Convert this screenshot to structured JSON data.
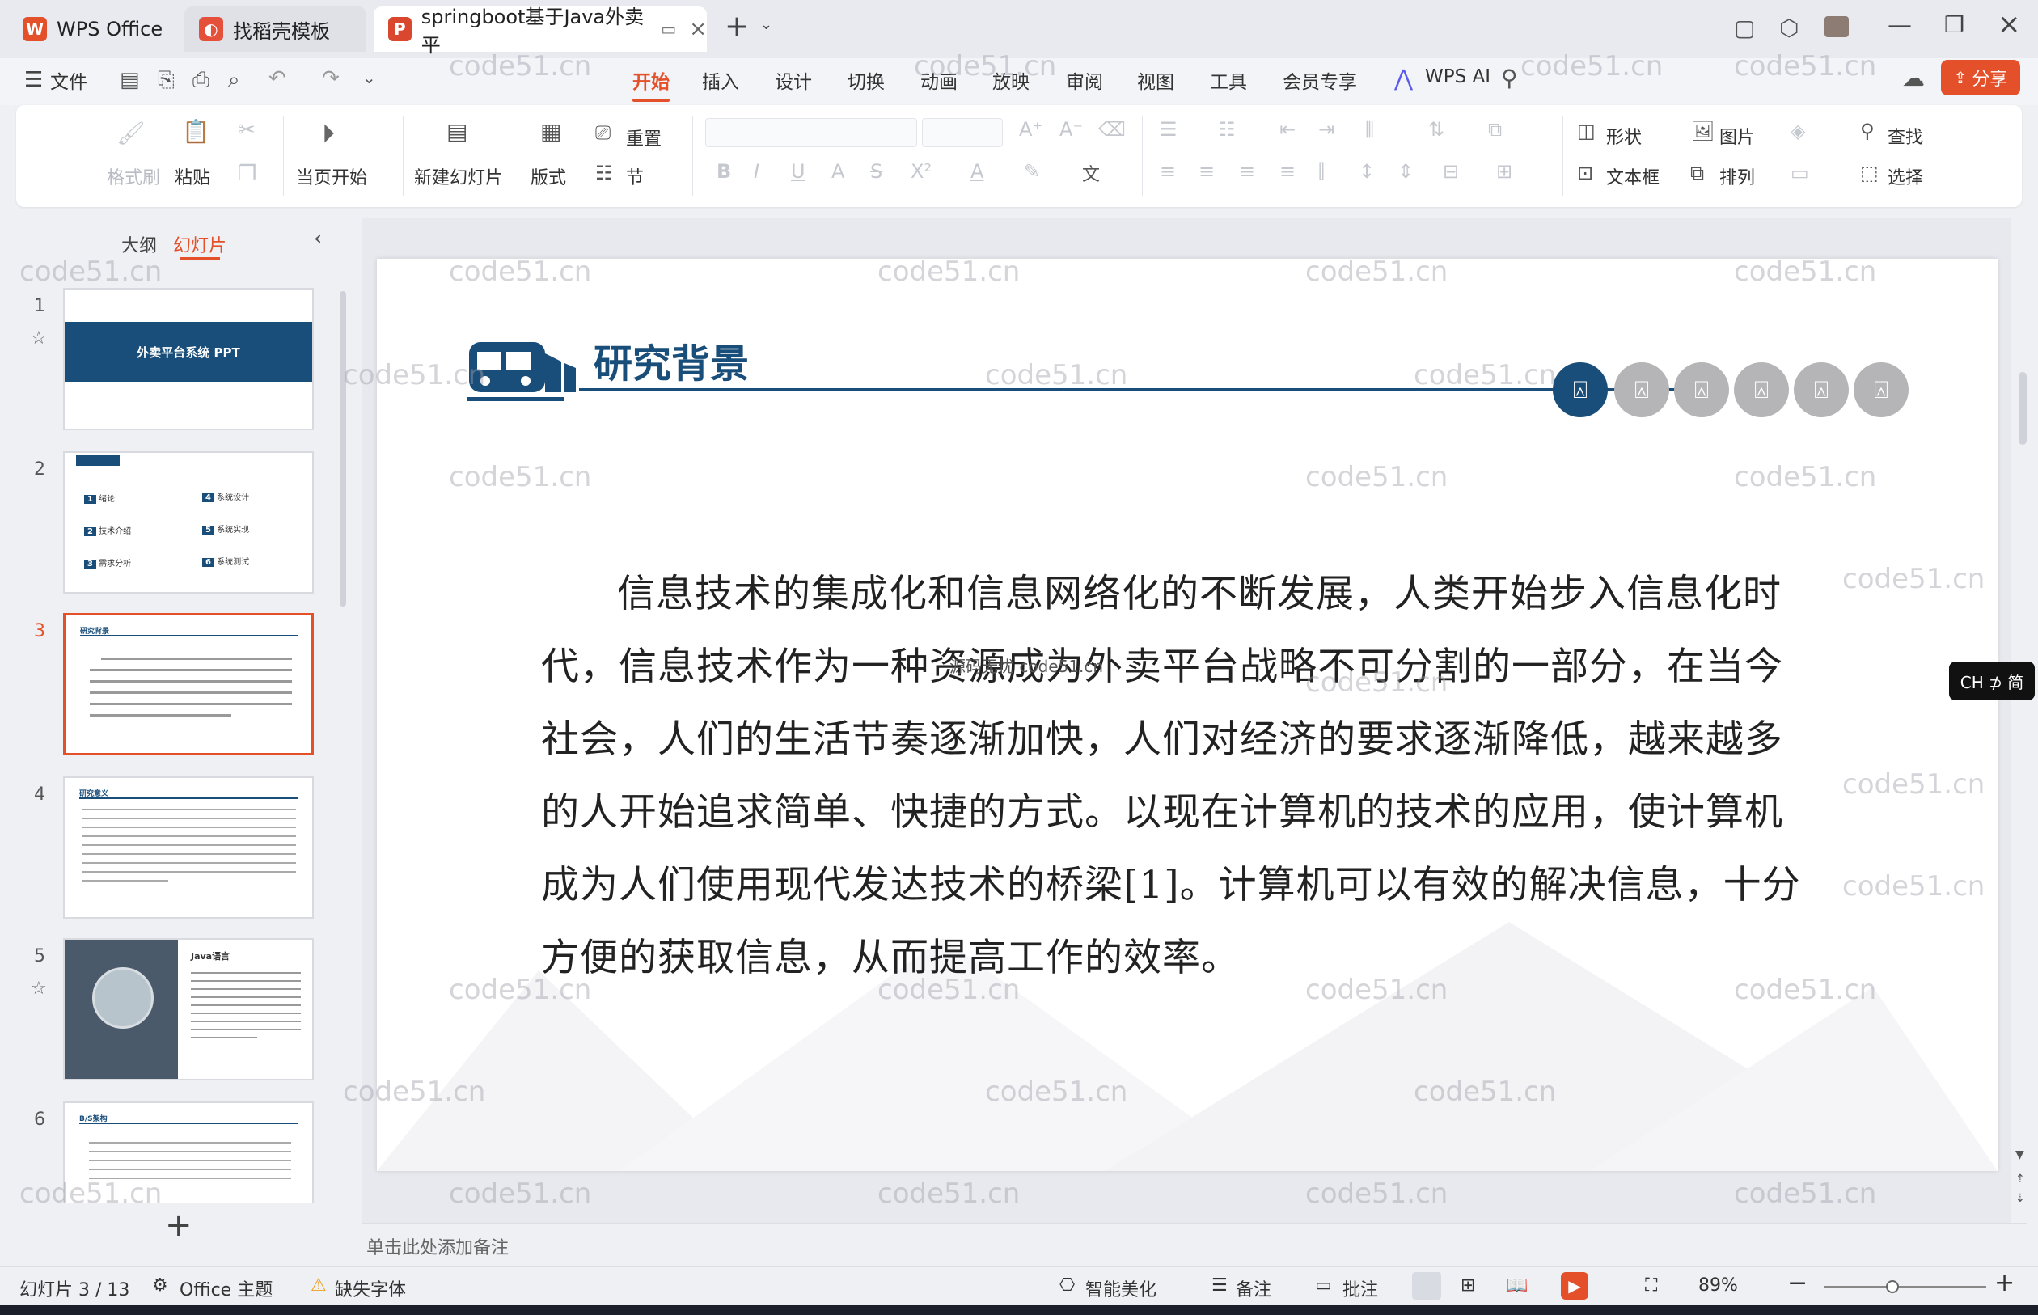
{
  "titlebar": {
    "tabs": [
      {
        "label": "WPS Office",
        "icon": "wps-logo-icon"
      },
      {
        "label": "找稻壳模板",
        "icon": "docer-icon"
      },
      {
        "label": "springboot基于Java外卖平",
        "icon": "ppt-file-icon"
      }
    ]
  },
  "menubar": {
    "file_label": "文件",
    "tabs": [
      "开始",
      "插入",
      "设计",
      "切换",
      "动画",
      "放映",
      "审阅",
      "视图",
      "工具",
      "会员专享"
    ],
    "active_tab": "开始",
    "wps_ai_label": "WPS AI",
    "share_label": "分享"
  },
  "ribbon": {
    "format_painter": "格式刷",
    "paste": "粘贴",
    "play_from_current": "当页开始",
    "new_slide": "新建幻灯片",
    "layout": "版式",
    "reset": "重置",
    "section": "节",
    "shape": "形状",
    "picture": "图片",
    "find": "查找",
    "textbox": "文本框",
    "arrange": "排列",
    "select": "选择"
  },
  "panel": {
    "outline_tab": "大纲",
    "slides_tab": "幻灯片",
    "thumbnails": [
      {
        "num": "1",
        "title": "外卖平台系统 PPT"
      },
      {
        "num": "2",
        "items": [
          "绪论",
          "技术介绍",
          "需求分析",
          "系统设计",
          "系统实现",
          "系统测试"
        ]
      },
      {
        "num": "3",
        "title": "研究背景"
      },
      {
        "num": "4",
        "title": "研究意义"
      },
      {
        "num": "5",
        "title": "Java语言"
      },
      {
        "num": "6",
        "title": "B/S架构"
      }
    ],
    "add_label": "+"
  },
  "slide": {
    "title": "研究背景",
    "body": "信息技术的集成化和信息网络化的不断发展，人类开始步入信息化时代，信息技术作为一种资源成为外卖平台战略不可分割的一部分，在当今社会，人们的生活节奏逐渐加快，人们对经济的要求逐渐降低，越来越多的人开始追求简单、快捷的方式。以现在计算机的技术的应用，使计算机成为人们使用现代发达技术的桥梁[1]。计算机可以有效的解决信息，十分方便的获取信息，从而提高工作的效率。",
    "inline_watermark": "源码无忧 code51.cn",
    "accent_color": "#1a4e7a"
  },
  "notes_placeholder": "单击此处添加备注",
  "ime_label": "CH ⊅ 简",
  "status": {
    "slide_counter": "幻灯片 3 / 13",
    "theme": "Office 主题",
    "missing_font": "缺失字体",
    "beautify": "智能美化",
    "notes": "备注",
    "comments": "批注",
    "zoom": "89%"
  },
  "watermark": "code51.cn"
}
